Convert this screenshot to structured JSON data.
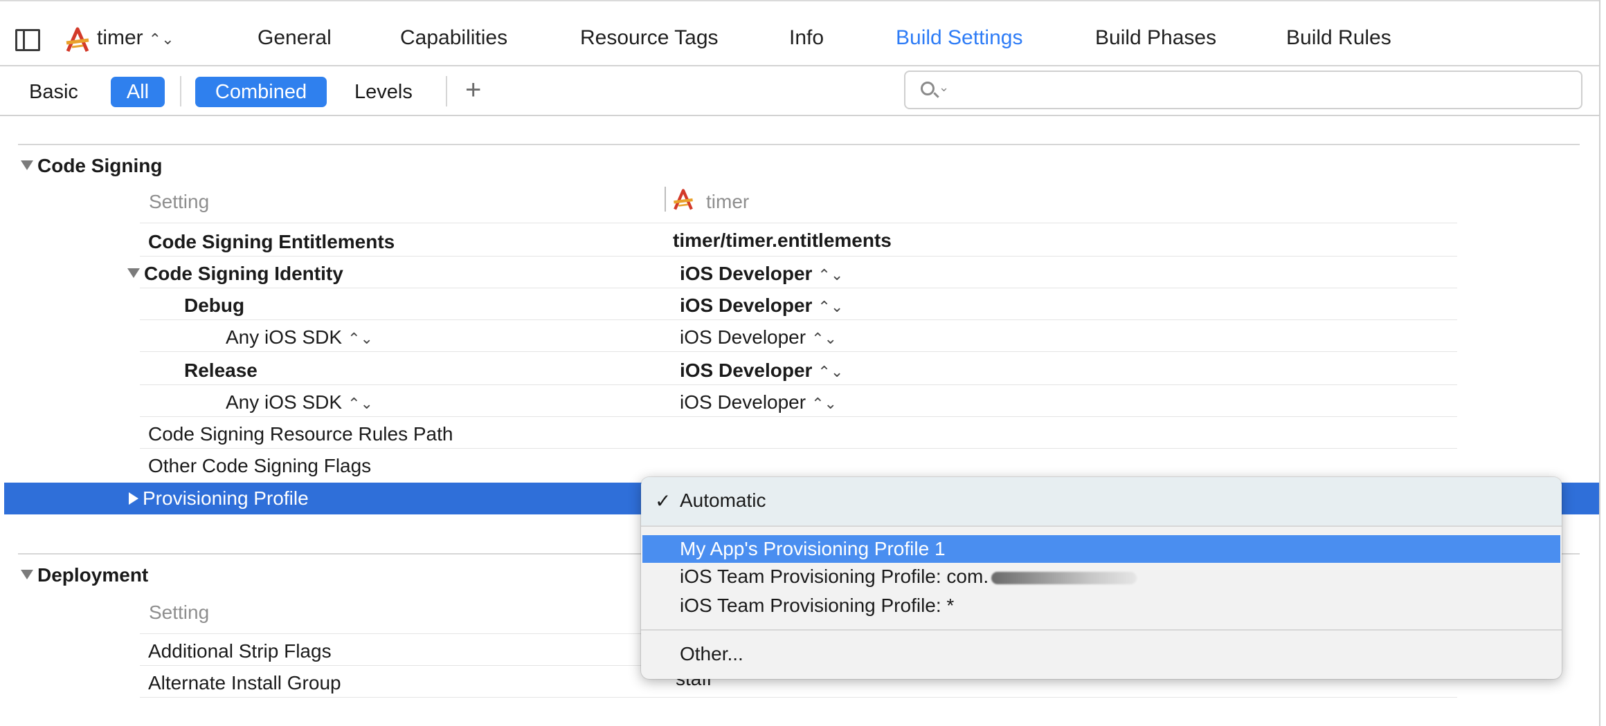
{
  "header": {
    "target_name": "timer",
    "tabs": [
      "General",
      "Capabilities",
      "Resource Tags",
      "Info",
      "Build Settings",
      "Build Phases",
      "Build Rules"
    ],
    "active_tab": "Build Settings",
    "accent_color": "#2e7cf6"
  },
  "filter": {
    "basic": "Basic",
    "all": "All",
    "combined": "Combined",
    "levels": "Levels",
    "add": "+",
    "search_placeholder": ""
  },
  "code_signing": {
    "title": "Code Signing",
    "col_setting": "Setting",
    "col_target": "timer",
    "rows": {
      "entitlements": {
        "label": "Code Signing Entitlements",
        "value": "timer/timer.entitlements"
      },
      "identity": {
        "label": "Code Signing Identity",
        "value": "iOS Developer"
      },
      "debug": {
        "label": "Debug",
        "value": "iOS Developer"
      },
      "debug_sdk": {
        "label": "Any iOS SDK",
        "value": "iOS Developer"
      },
      "release": {
        "label": "Release",
        "value": "iOS Developer"
      },
      "release_sdk": {
        "label": "Any iOS SDK",
        "value": "iOS Developer"
      },
      "resource_rules": {
        "label": "Code Signing Resource Rules Path",
        "value": ""
      },
      "other_flags": {
        "label": "Other Code Signing Flags",
        "value": ""
      },
      "provisioning": {
        "label": "Provisioning Profile"
      }
    }
  },
  "deployment": {
    "title": "Deployment",
    "col_setting": "Setting",
    "rows": {
      "strip_flags": {
        "label": "Additional Strip Flags"
      },
      "install_group": {
        "label": "Alternate Install Group",
        "value": "staff"
      }
    }
  },
  "popup_menu": {
    "checked_item": "Automatic",
    "items": [
      "My App's Provisioning Profile 1",
      "iOS Team Provisioning Profile: com.",
      "iOS Team Provisioning Profile: *"
    ],
    "highlighted_item": "My App's Provisioning Profile 1",
    "other": "Other..."
  }
}
